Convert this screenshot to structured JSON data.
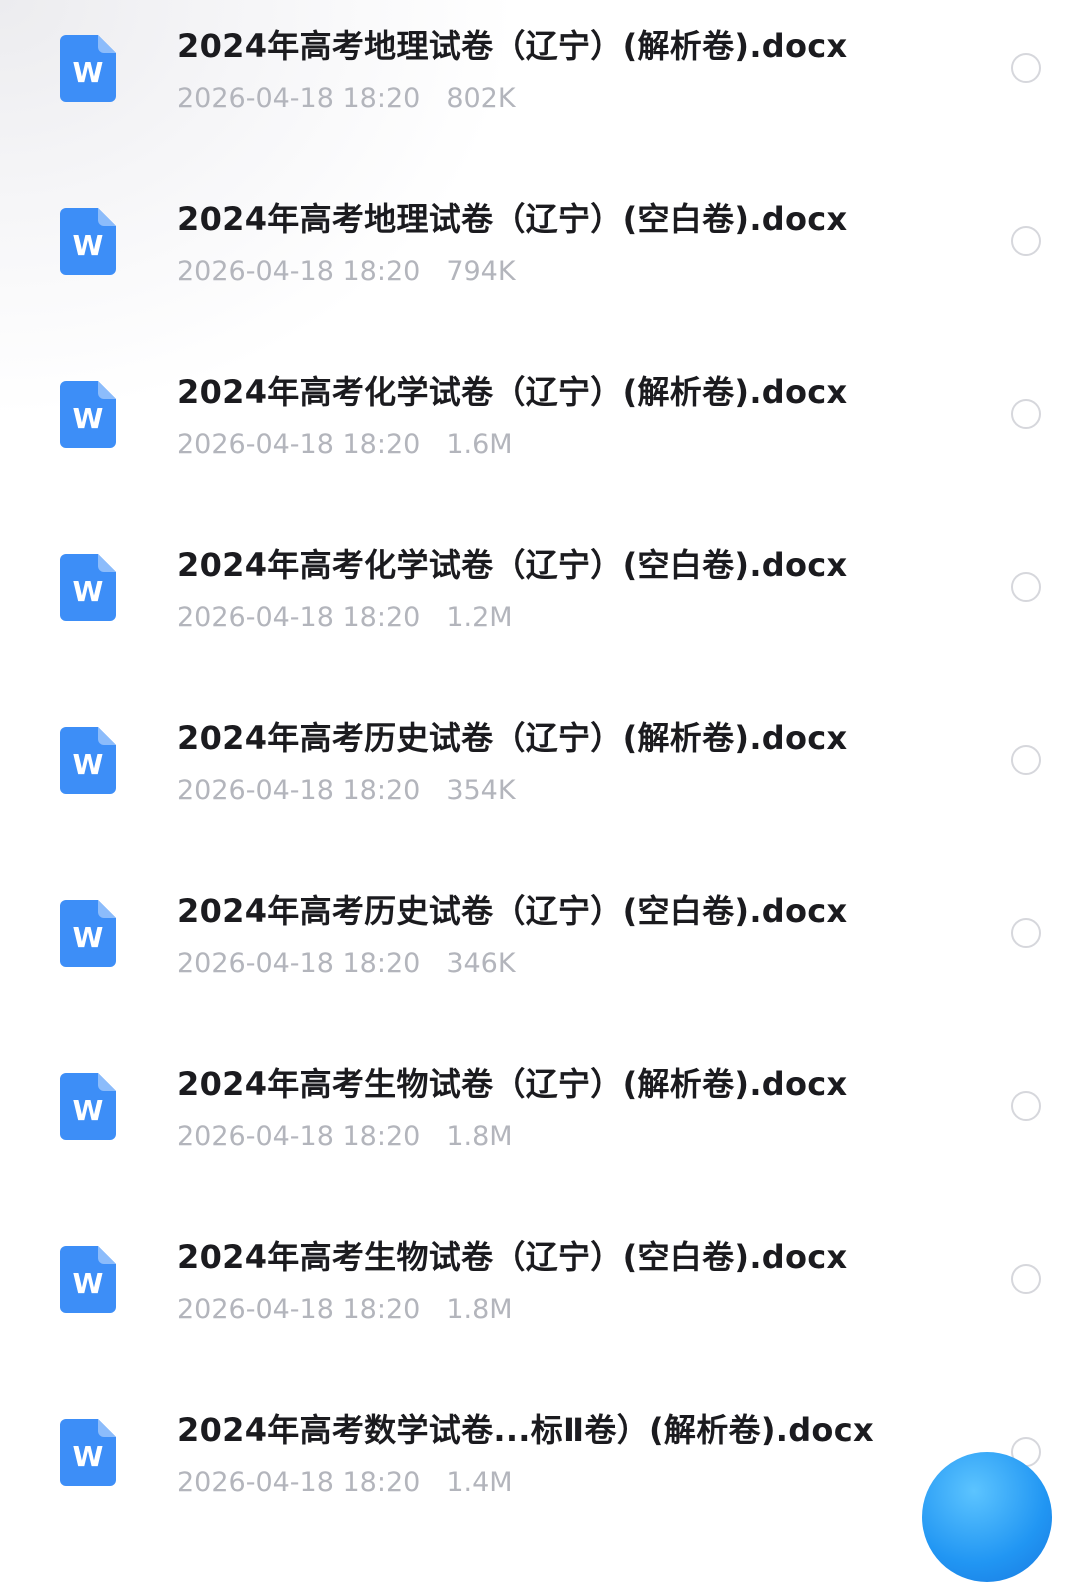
{
  "colors": {
    "icon_blue": "#3d8ef7",
    "title_text": "#1b1b1f",
    "meta_text": "#b3b5bc",
    "radio_border": "#d6d7dc",
    "fab_blue": "#2196f3"
  },
  "files": [
    {
      "name": "2024年高考地理试卷（辽宁）(解析卷).docx",
      "date": "2026-04-18 18:20",
      "size": "802K",
      "icon": "word-doc-icon",
      "icon_letter": "W"
    },
    {
      "name": "2024年高考地理试卷（辽宁）(空白卷).docx",
      "date": "2026-04-18 18:20",
      "size": "794K",
      "icon": "word-doc-icon",
      "icon_letter": "W"
    },
    {
      "name": "2024年高考化学试卷（辽宁）(解析卷).docx",
      "date": "2026-04-18 18:20",
      "size": "1.6M",
      "icon": "word-doc-icon",
      "icon_letter": "W"
    },
    {
      "name": "2024年高考化学试卷（辽宁）(空白卷).docx",
      "date": "2026-04-18 18:20",
      "size": "1.2M",
      "icon": "word-doc-icon",
      "icon_letter": "W"
    },
    {
      "name": "2024年高考历史试卷（辽宁）(解析卷).docx",
      "date": "2026-04-18 18:20",
      "size": "354K",
      "icon": "word-doc-icon",
      "icon_letter": "W"
    },
    {
      "name": "2024年高考历史试卷（辽宁）(空白卷).docx",
      "date": "2026-04-18 18:20",
      "size": "346K",
      "icon": "word-doc-icon",
      "icon_letter": "W"
    },
    {
      "name": "2024年高考生物试卷（辽宁）(解析卷).docx",
      "date": "2026-04-18 18:20",
      "size": "1.8M",
      "icon": "word-doc-icon",
      "icon_letter": "W"
    },
    {
      "name": "2024年高考生物试卷（辽宁）(空白卷).docx",
      "date": "2026-04-18 18:20",
      "size": "1.8M",
      "icon": "word-doc-icon",
      "icon_letter": "W"
    },
    {
      "name": "2024年高考数学试卷...标Ⅱ卷）(解析卷).docx",
      "date": "2026-04-18 18:20",
      "size": "1.4M",
      "icon": "word-doc-icon",
      "icon_letter": "W"
    }
  ]
}
